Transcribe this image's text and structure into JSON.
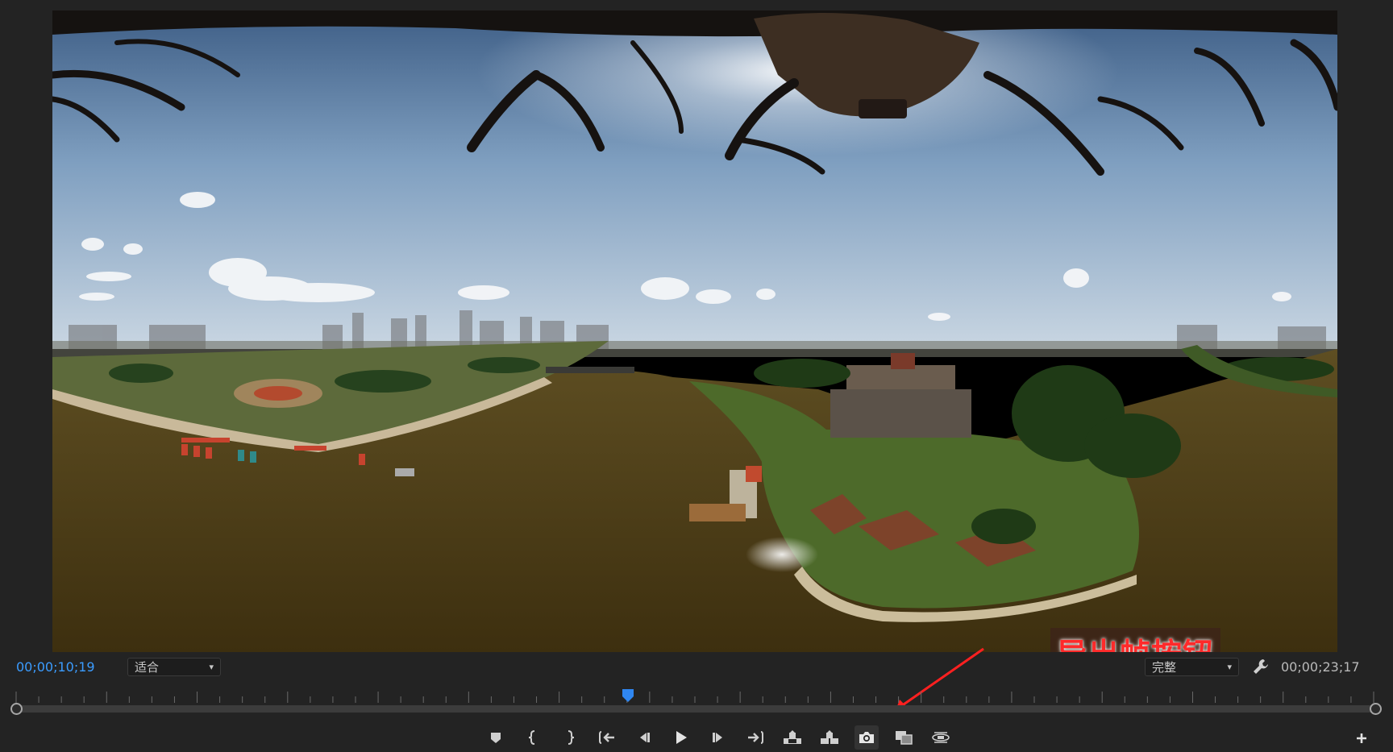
{
  "program_monitor": {
    "current_timecode": "00;00;10;19",
    "duration_timecode": "00;00;23;17",
    "zoom_level": "适合",
    "playback_resolution": "完整",
    "playhead_position": 0.45,
    "annotation": {
      "text": "导出帧按钮"
    }
  },
  "transport": {
    "buttons": [
      {
        "name": "add-marker-button",
        "icon": "marker-icon"
      },
      {
        "name": "mark-in-button",
        "icon": "mark-in-icon"
      },
      {
        "name": "mark-out-button",
        "icon": "mark-out-icon"
      },
      {
        "name": "go-to-in-button",
        "icon": "go-to-in-icon"
      },
      {
        "name": "step-back-button",
        "icon": "step-back-icon"
      },
      {
        "name": "play-button",
        "icon": "play-icon"
      },
      {
        "name": "step-forward-button",
        "icon": "step-forward-icon"
      },
      {
        "name": "go-to-out-button",
        "icon": "go-to-out-icon"
      },
      {
        "name": "lift-button",
        "icon": "lift-icon"
      },
      {
        "name": "extract-button",
        "icon": "extract-icon"
      },
      {
        "name": "export-frame-button",
        "icon": "camera-icon"
      },
      {
        "name": "comparison-view-button",
        "icon": "comparison-icon"
      },
      {
        "name": "vr-video-button",
        "icon": "vr-icon"
      }
    ]
  },
  "colors": {
    "panel_bg": "#232323",
    "timecode_current": "#3b9cff",
    "timecode_duration": "#b9b9b9",
    "playhead": "#2f86f0",
    "annotation_text": "#ff2a2a"
  }
}
